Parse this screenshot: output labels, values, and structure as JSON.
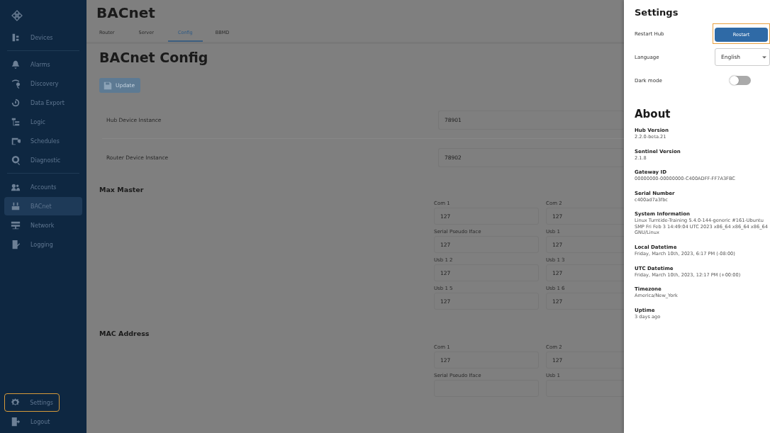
{
  "sidebar": {
    "groups": [
      {
        "items": [
          {
            "label": "Devices",
            "selected": false,
            "highlighted": false
          }
        ]
      },
      {
        "items": [
          {
            "label": "Alarms",
            "selected": false,
            "highlighted": false
          },
          {
            "label": "Discovery",
            "selected": false,
            "highlighted": false
          },
          {
            "label": "Data Export",
            "selected": false,
            "highlighted": false
          },
          {
            "label": "Logic",
            "selected": false,
            "highlighted": false
          },
          {
            "label": "Schedules",
            "selected": false,
            "highlighted": false
          },
          {
            "label": "Diagnostic",
            "selected": false,
            "highlighted": false
          }
        ]
      },
      {
        "items": [
          {
            "label": "Accounts",
            "selected": false,
            "highlighted": false
          },
          {
            "label": "BACnet",
            "selected": true,
            "highlighted": false
          },
          {
            "label": "Network",
            "selected": false,
            "highlighted": false
          },
          {
            "label": "Logging",
            "selected": false,
            "highlighted": false
          }
        ]
      }
    ],
    "bottom_items": [
      {
        "label": "Settings",
        "selected": false,
        "highlighted": true
      },
      {
        "label": "Logout",
        "selected": false,
        "highlighted": false
      }
    ]
  },
  "page": {
    "title": "BACnet",
    "tabs": [
      {
        "label": "Router",
        "selected": false
      },
      {
        "label": "Server",
        "selected": false
      },
      {
        "label": "Config",
        "selected": true
      },
      {
        "label": "BBMD",
        "selected": false
      }
    ],
    "heading": "BACnet Config",
    "update_button": {
      "label": "Update",
      "disabled": true
    },
    "instances": [
      {
        "label": "Hub Device Instance",
        "value": "78901"
      },
      {
        "label": "Router Device Instance",
        "value": "78902"
      }
    ],
    "sections": [
      {
        "title": "Max Master",
        "fields": [
          {
            "label": "Com 1",
            "value": "127"
          },
          {
            "label": "Com 2",
            "value": "127"
          },
          {
            "label": "Serial Pseudo Iface",
            "value": "127"
          },
          {
            "label": "Usb 1",
            "value": "127"
          },
          {
            "label": "Usb 1 2",
            "value": "127"
          },
          {
            "label": "Usb 1 3",
            "value": "127"
          },
          {
            "label": "Usb 1 5",
            "value": "127"
          },
          {
            "label": "Usb 1 6",
            "value": "127"
          }
        ]
      },
      {
        "title": "MAC Address",
        "fields": [
          {
            "label": "Com 1",
            "value": "127"
          },
          {
            "label": "Com 2",
            "value": "127"
          },
          {
            "label": "Serial Pseudo Iface"
          },
          {
            "label": "Usb 1"
          }
        ]
      }
    ]
  },
  "settings": {
    "title": "Settings",
    "restart": {
      "label": "Restart Hub",
      "button": "Restart",
      "highlighted": true
    },
    "language": {
      "label": "Language",
      "value": "English"
    },
    "dark_mode": {
      "label": "Dark mode",
      "on": false
    }
  },
  "about": {
    "title": "About",
    "items": [
      {
        "label": "Hub Version",
        "value": "2.2.0-beta.21"
      },
      {
        "label": "Sentinel Version",
        "value": "2.1.8"
      },
      {
        "label": "Gateway ID",
        "value": "00000000-00000000-C400ADFF-FF7A3FBC"
      },
      {
        "label": "Serial Number",
        "value": "c400ad7a3fbc"
      },
      {
        "label": "System Information",
        "value": "Linux Turntide-Training 5.4.0-144-generic #161-Ubuntu SMP Fri Feb 3 14:49:04 UTC 2023 x86_64 x86_64 x86_64 GNU/Linux"
      },
      {
        "label": "Local Datetime",
        "value": "Friday, March 10th, 2023, 6:17 PM (-08:00)"
      },
      {
        "label": "UTC Datetime",
        "value": "Friday, March 10th, 2023, 12:17 PM (+00:00)"
      },
      {
        "label": "Timezone",
        "value": "America/New_York"
      },
      {
        "label": "Uptime",
        "value": "3 days ago"
      }
    ]
  }
}
